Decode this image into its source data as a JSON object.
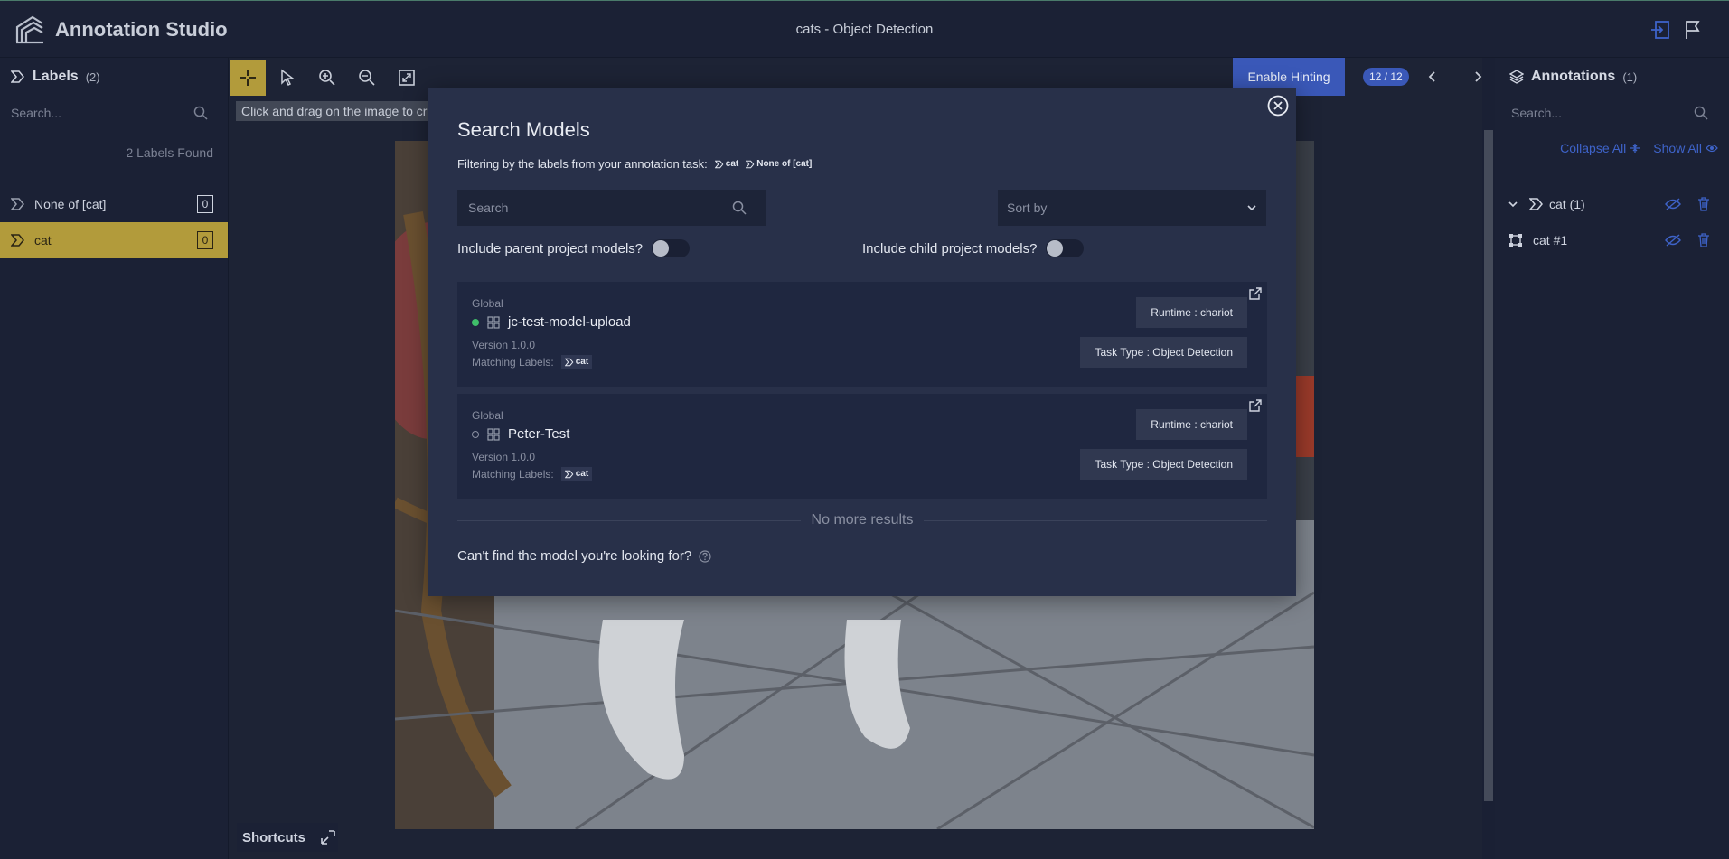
{
  "app": {
    "title": "Annotation Studio",
    "document_title": "cats - Object Detection"
  },
  "labels_panel": {
    "title": "Labels",
    "count": "(2)",
    "search_placeholder": "Search...",
    "found_text": "2 Labels Found",
    "items": [
      {
        "name": "None of [cat]",
        "count": "0",
        "active": false
      },
      {
        "name": "cat",
        "count": "0",
        "active": true
      }
    ]
  },
  "canvas": {
    "hint_text": "Click and drag on the image to create",
    "enable_hinting": "Enable Hinting",
    "pager": "12 / 12",
    "shortcuts": "Shortcuts"
  },
  "annotations_panel": {
    "title": "Annotations",
    "count": "(1)",
    "search_placeholder": "Search...",
    "collapse_all": "Collapse All",
    "show_all": "Show All",
    "groups": [
      {
        "label": "cat (1)"
      }
    ],
    "items": [
      {
        "label": "cat #1"
      }
    ]
  },
  "modal": {
    "title": "Search Models",
    "filter_text": "Filtering by the labels from your annotation task:",
    "filter_chips": [
      "cat",
      "None of [cat]"
    ],
    "search_placeholder": "Search",
    "sort_placeholder": "Sort by",
    "include_parent": "Include parent project models?",
    "include_child": "Include child project models?",
    "matching_label_text": "Matching Labels:",
    "models": [
      {
        "scope": "Global",
        "name": "jc-test-model-upload",
        "version": "Version 1.0.0",
        "matching_labels": [
          "cat"
        ],
        "runtime": "Runtime : chariot",
        "task_type": "Task Type : Object Detection",
        "status": "active",
        "status_color": "#3fbf6a"
      },
      {
        "scope": "Global",
        "name": "Peter-Test",
        "version": "Version 1.0.0",
        "matching_labels": [
          "cat"
        ],
        "runtime": "Runtime : chariot",
        "task_type": "Task Type : Object Detection",
        "status": "inactive",
        "status_color": "#8a90a2"
      }
    ],
    "no_more": "No more results",
    "cant_find": "Can't find the model you're looking for?"
  },
  "colors": {
    "accent": "#b29b3b",
    "primary": "#3a58b8",
    "link": "#3e63c9"
  }
}
